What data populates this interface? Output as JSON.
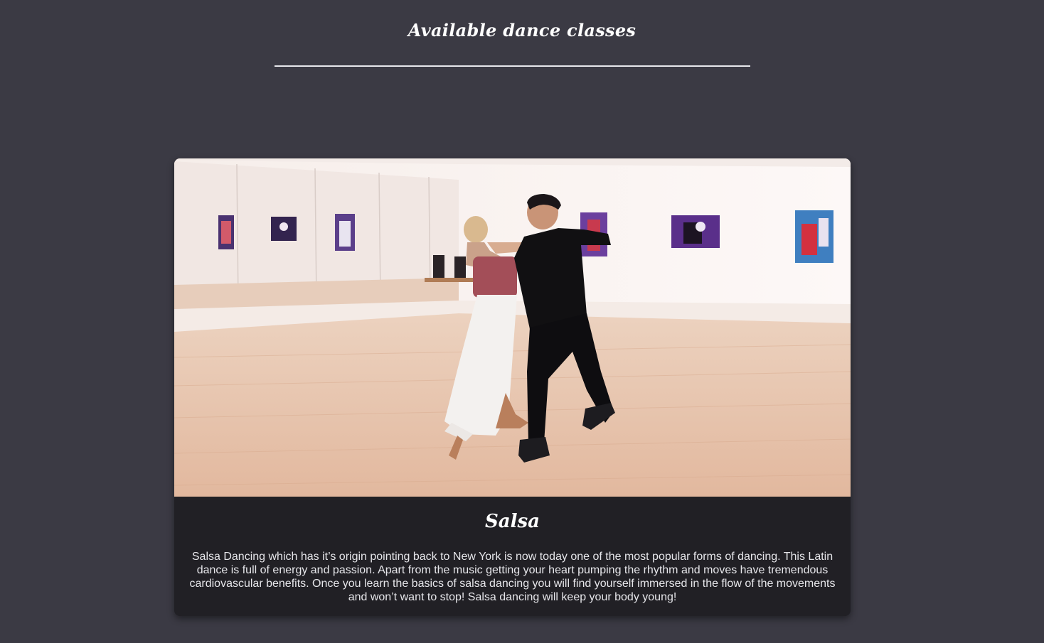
{
  "header": {
    "title": "Available dance classes"
  },
  "classes": [
    {
      "name": "Salsa",
      "image_icon": "dance-couple-photo",
      "description": "Salsa Dancing which has it’s origin pointing back to New York is now today one of the most popular forms of dancing. This Latin dance is full of energy and passion. Apart from the music getting your heart pumping the rhythm and moves have tremendous cardiovascular benefits. Once you learn the basics of salsa dancing you will find yourself immersed in the flow of the movements and won’t want to stop! Salsa dancing will keep your body young!"
    }
  ],
  "colors": {
    "page_background": "#3b3a44",
    "card_background": "#212025",
    "rule": "#e8e8ec",
    "title_text": "#ffffff",
    "body_text": "#e6e6ea"
  }
}
